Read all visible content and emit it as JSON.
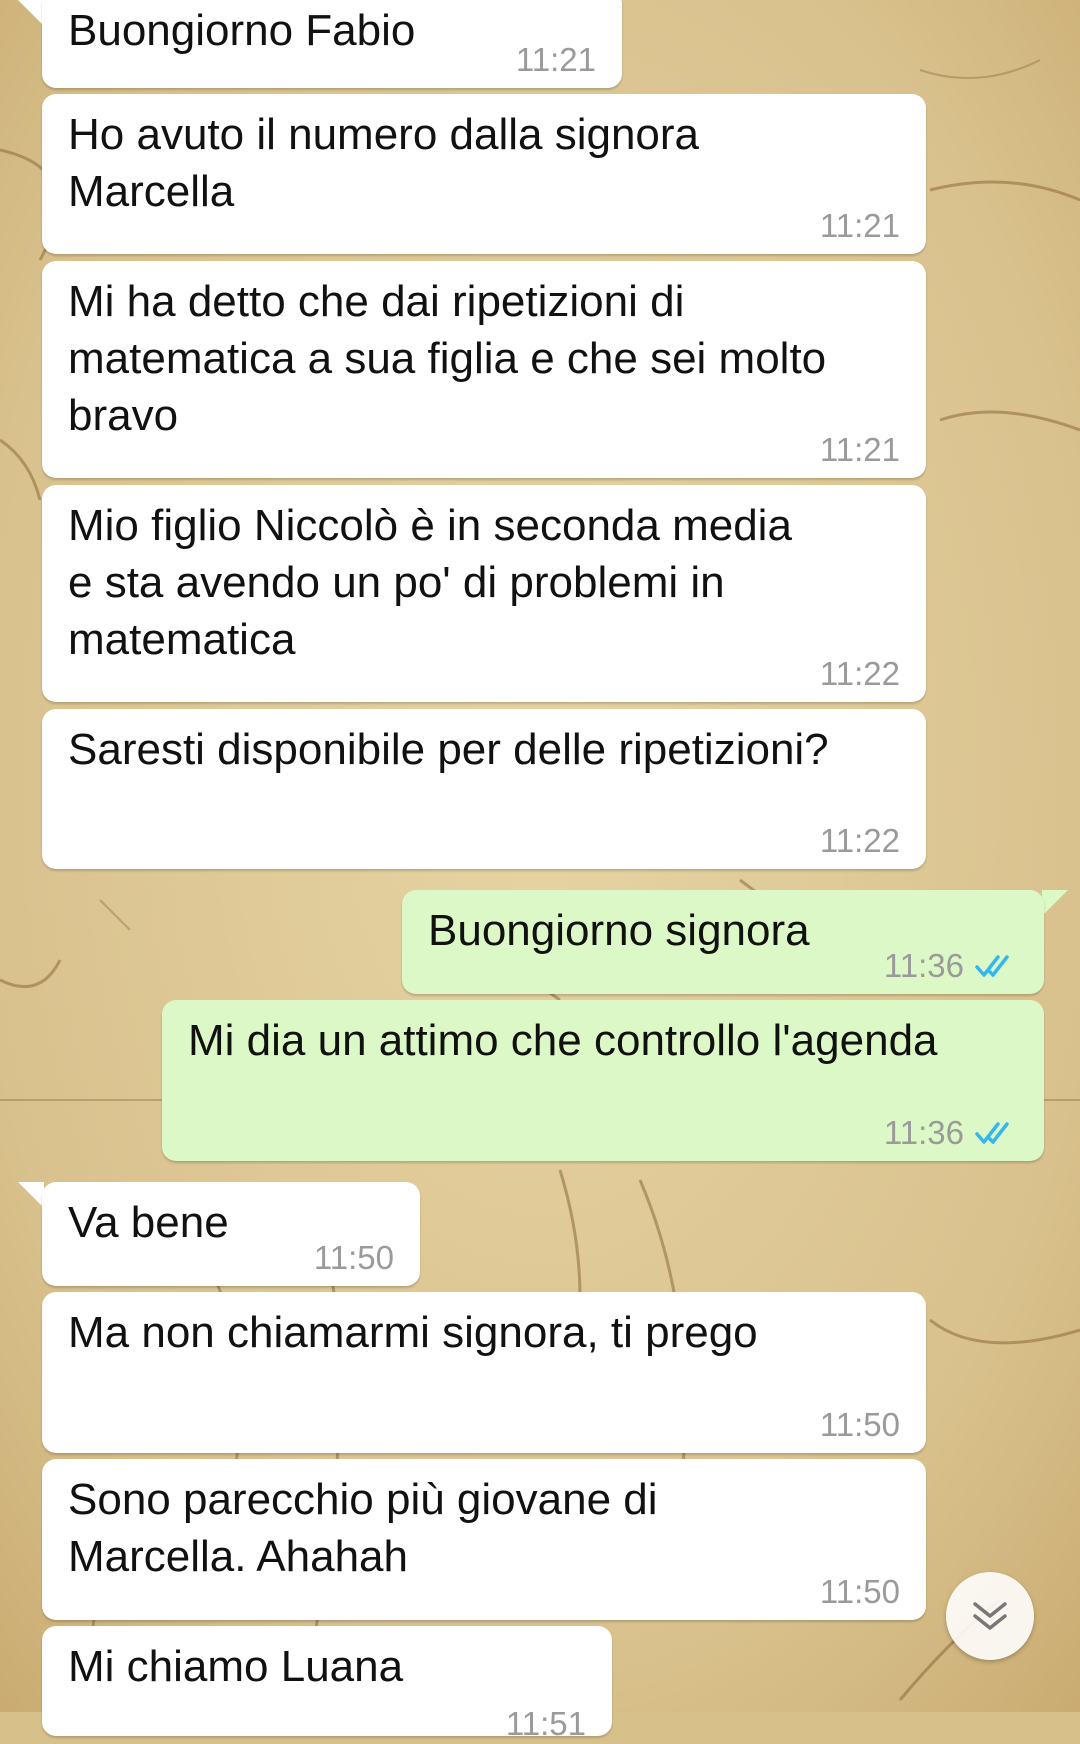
{
  "messages": [
    {
      "direction": "in",
      "text": "Buongiorno Fabio",
      "time": "11:21"
    },
    {
      "direction": "in",
      "text": "Ho avuto il numero dalla signora\nMarcella",
      "time": "11:21"
    },
    {
      "direction": "in",
      "text": "Mi ha detto che dai ripetizioni di\nmatematica a sua figlia e che sei molto\nbravo",
      "time": "11:21"
    },
    {
      "direction": "in",
      "text": "Mio figlio Niccolò è in seconda media\ne sta avendo un po' di problemi in\nmatematica",
      "time": "11:22"
    },
    {
      "direction": "in",
      "text": "Saresti disponibile per delle ripetizioni?",
      "time": "11:22"
    },
    {
      "direction": "out",
      "text": "Buongiorno signora",
      "time": "11:36",
      "status": "read"
    },
    {
      "direction": "out",
      "text": "Mi dia un attimo che controllo l'agenda",
      "time": "11:36",
      "status": "read"
    },
    {
      "direction": "in",
      "text": "Va bene",
      "time": "11:50"
    },
    {
      "direction": "in",
      "text": "Ma non chiamarmi signora, ti prego",
      "time": "11:50"
    },
    {
      "direction": "in",
      "text": "Sono parecchio più giovane di\nMarcella. Ahahah",
      "time": "11:50"
    },
    {
      "direction": "in",
      "text": "Mi chiamo Luana",
      "time": "11:51"
    }
  ],
  "scroll_button": {
    "icon": "double-chevron-down-icon"
  },
  "colors": {
    "incoming_bubble": "#ffffff",
    "outgoing_bubble": "#dcf8c6",
    "timestamp": "#9a9a9a",
    "read_ticks": "#34b7f1",
    "wallpaper": "#d8c08a"
  },
  "wallpaper": {
    "style": "vitruvian-sketch-parchment"
  }
}
